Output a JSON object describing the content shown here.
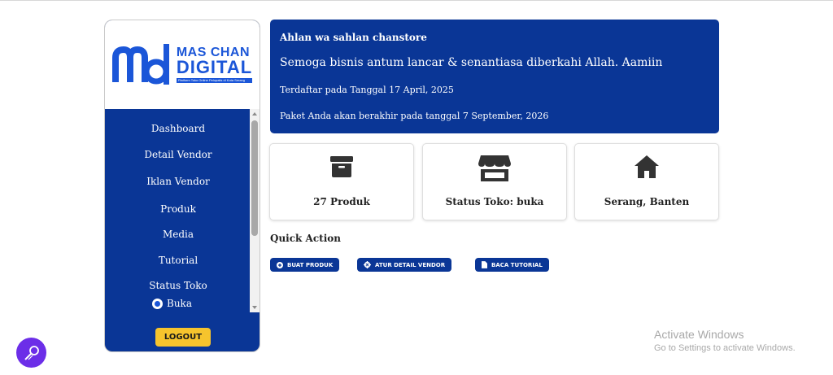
{
  "brand": {
    "line1": "MAS CHAN",
    "line2": "DIGITAL",
    "tagline": "Platform Toko Online Pelopatis di Kota Serang",
    "color": "#1b56d8"
  },
  "sidebar": {
    "items": [
      {
        "label": "Dashboard"
      },
      {
        "label": "Detail Vendor"
      },
      {
        "label": "Iklan Vendor"
      },
      {
        "label": "Produk"
      },
      {
        "label": "Media"
      },
      {
        "label": "Tutorial"
      }
    ],
    "status_label": "Status Toko",
    "status_option": "Buka",
    "status_selected": true,
    "logout_label": "LOGOUT",
    "bg_color": "#0a3696"
  },
  "welcome": {
    "greeting": "Ahlan wa sahlan chanstore",
    "wish": "Semoga bisnis antum lancar & senantiasa diberkahi Allah. Aamiin",
    "registered": "Terdaftar pada Tanggal 17 April, 2025",
    "expires": "Paket Anda akan berakhir pada tanggal 7 September, 2026"
  },
  "cards": [
    {
      "icon": "archive-box-icon",
      "label": "27 Produk"
    },
    {
      "icon": "store-icon",
      "label": "Status Toko: buka"
    },
    {
      "icon": "home-icon",
      "label": "Serang, Banten"
    }
  ],
  "quick_action": {
    "title": "Quick Action",
    "buttons": [
      {
        "icon": "plus-circle-icon",
        "label": "BUAT PRODUK"
      },
      {
        "icon": "gear-icon",
        "label": "ATUR DETAIL VENDOR"
      },
      {
        "icon": "document-icon",
        "label": "BACA TUTORIAL"
      }
    ]
  },
  "overlay": {
    "activate_title": "Activate Windows",
    "activate_sub": "Go to Settings to activate Windows."
  },
  "colors": {
    "primary": "#0a3696",
    "accent": "#f6c42d",
    "assistant": "#6c2ee8"
  }
}
